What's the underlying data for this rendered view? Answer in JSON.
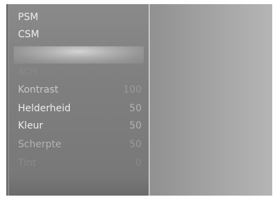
{
  "menu": {
    "items": [
      {
        "label": "PSM",
        "value": ""
      },
      {
        "label": "CSM",
        "value": ""
      },
      {
        "label": "",
        "value": ""
      },
      {
        "label": "ACM",
        "value": ""
      },
      {
        "label": "Kontrast",
        "value": "100"
      },
      {
        "label": "Helderheid",
        "value": "50"
      },
      {
        "label": "Kleur",
        "value": "50"
      },
      {
        "label": "Scherpte",
        "value": "50"
      },
      {
        "label": "Tint",
        "value": "0"
      }
    ]
  }
}
